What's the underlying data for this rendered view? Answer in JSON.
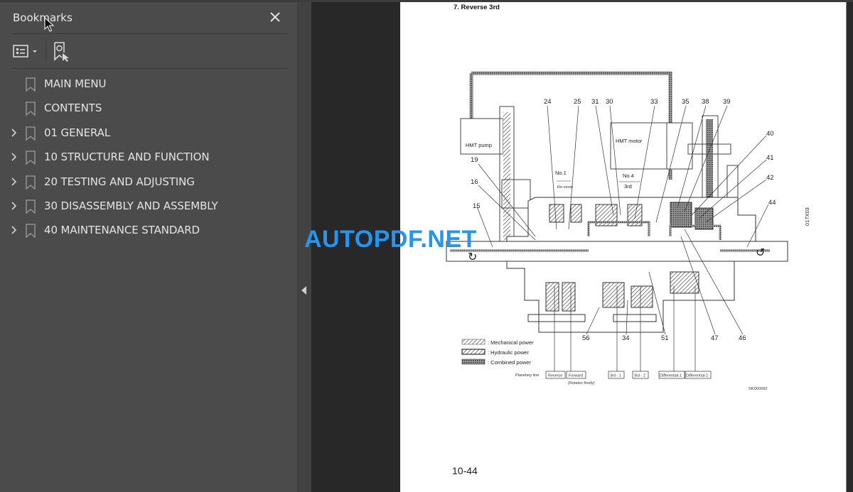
{
  "sidebar": {
    "title": "Bookmarks",
    "close_icon": "close-icon",
    "options_icon": "bookmark-options-icon",
    "find_icon": "find-current-bookmark-icon",
    "items": [
      {
        "label": "MAIN MENU",
        "expandable": false
      },
      {
        "label": "CONTENTS",
        "expandable": false
      },
      {
        "label": "01 GENERAL",
        "expandable": true
      },
      {
        "label": "10 STRUCTURE AND FUNCTION",
        "expandable": true
      },
      {
        "label": "20 TESTING AND ADJUSTING",
        "expandable": true
      },
      {
        "label": "30 DISASSEMBLY AND ASSEMBLY",
        "expandable": true
      },
      {
        "label": "40 MAINTENANCE STANDARD",
        "expandable": true
      }
    ]
  },
  "collapse_icon": "collapse-panel-arrow-icon",
  "watermark": "AUTOPDF.NET",
  "page": {
    "heading": "7.   Reverse 3rd",
    "page_number": "10-44",
    "diagram": {
      "boxes": {
        "hmt_pump": "HMT pump",
        "hmt_motor": "HMT motor"
      },
      "top_labels": [
        "24",
        "25",
        "31",
        "30",
        "33",
        "35",
        "38",
        "39"
      ],
      "right_labels": [
        "40",
        "41",
        "42",
        "44"
      ],
      "left_labels": [
        "19",
        "16",
        "15"
      ],
      "bottom_labels": [
        "56",
        "34",
        "51",
        "47",
        "46"
      ],
      "clutch_no1": "No.1",
      "clutch_no1_sub": "Re-verse",
      "clutch_no4": "No.4",
      "clutch_no4_sub": "3rd",
      "side_code": "017X03",
      "figure_code": "SKD00062",
      "legend": [
        {
          "label": ": Mechanical power"
        },
        {
          "label": ": Hydraulic power"
        },
        {
          "label": ": Combined power"
        }
      ],
      "planetary_line_label": "Planetary line",
      "planetary_boxes": [
        "Reverse",
        "Forward",
        "3rd - 1",
        "3rd - 2",
        "Differential-1",
        "Differential-2"
      ],
      "forward_note": "(Rotates freely)"
    }
  }
}
